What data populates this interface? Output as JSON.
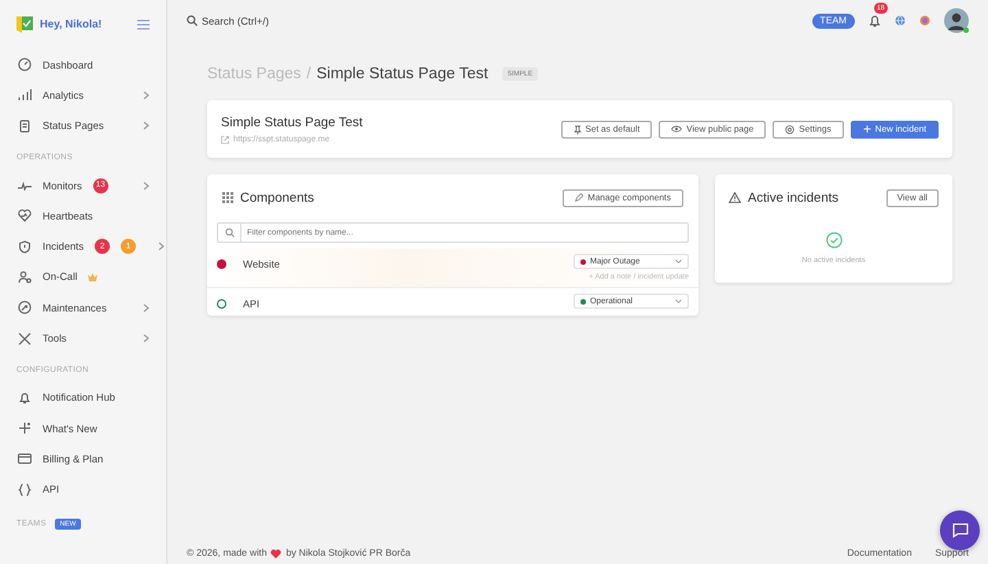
{
  "sidebar": {
    "greeting": "Hey, Nikola!",
    "sections": [
      {
        "items": [
          {
            "label": "Dashboard",
            "submenu": false
          },
          {
            "label": "Analytics",
            "submenu": true
          },
          {
            "label": "Status Pages",
            "submenu": true
          }
        ]
      },
      {
        "heading": "OPERATIONS",
        "items": [
          {
            "label": "Monitors",
            "submenu": true,
            "badges": [
              {
                "text": "13",
                "color": "#e8334a"
              }
            ]
          },
          {
            "label": "Heartbeats",
            "submenu": false
          },
          {
            "label": "Incidents",
            "submenu": true,
            "badges": [
              {
                "text": "2",
                "color": "#e8334a"
              },
              {
                "text": "1",
                "color": "#f0a030"
              }
            ]
          },
          {
            "label": "On-Call",
            "submenu": false,
            "premium": true
          },
          {
            "label": "Maintenances",
            "submenu": true
          },
          {
            "label": "Tools",
            "submenu": true
          }
        ]
      },
      {
        "heading": "CONFIGURATION",
        "items": [
          {
            "label": "Notification Hub",
            "submenu": false
          },
          {
            "label": "What's New",
            "submenu": false
          },
          {
            "label": "Billing & Plan",
            "submenu": false
          },
          {
            "label": "API",
            "submenu": false
          }
        ]
      }
    ],
    "teams": {
      "heading": "TEAMS",
      "badge": "NEW"
    }
  },
  "topbar": {
    "search": "Search (Ctrl+/)",
    "team_button": "TEAM",
    "notification_count": "18"
  },
  "breadcrumb": {
    "parent": "Status Pages",
    "separator": "/",
    "current": "Simple Status Page Test",
    "badge": "SIMPLE"
  },
  "page_card": {
    "title": "Simple Status Page Test",
    "url": "https://sspt.statuspage.me",
    "buttons": [
      {
        "label": "Set as default",
        "primary": false
      },
      {
        "label": "View public page",
        "primary": false
      },
      {
        "label": "Settings",
        "primary": false
      },
      {
        "label": "New incident",
        "primary": true
      }
    ]
  },
  "components": {
    "title": "Components",
    "manage_button": "Manage components",
    "filter": {
      "placeholder": "Filter components by name..."
    },
    "rows": [
      {
        "name": "Website",
        "kind": "filled",
        "color": "#c8103e",
        "status": "Major Outage",
        "highlighted": true,
        "note": "+ Add a note / incident update"
      },
      {
        "name": "API",
        "kind": "ring",
        "color": "#1e8a5a",
        "status": "Operational",
        "highlighted": false
      }
    ]
  },
  "incidents": {
    "title": "Active incidents",
    "view_all": "View all",
    "empty_text": "No active incidents"
  },
  "footer": {
    "copyright": "© 2026, made with",
    "author": "by Nikola Stojković PR Borča",
    "links": [
      "Documentation",
      "Support"
    ]
  }
}
